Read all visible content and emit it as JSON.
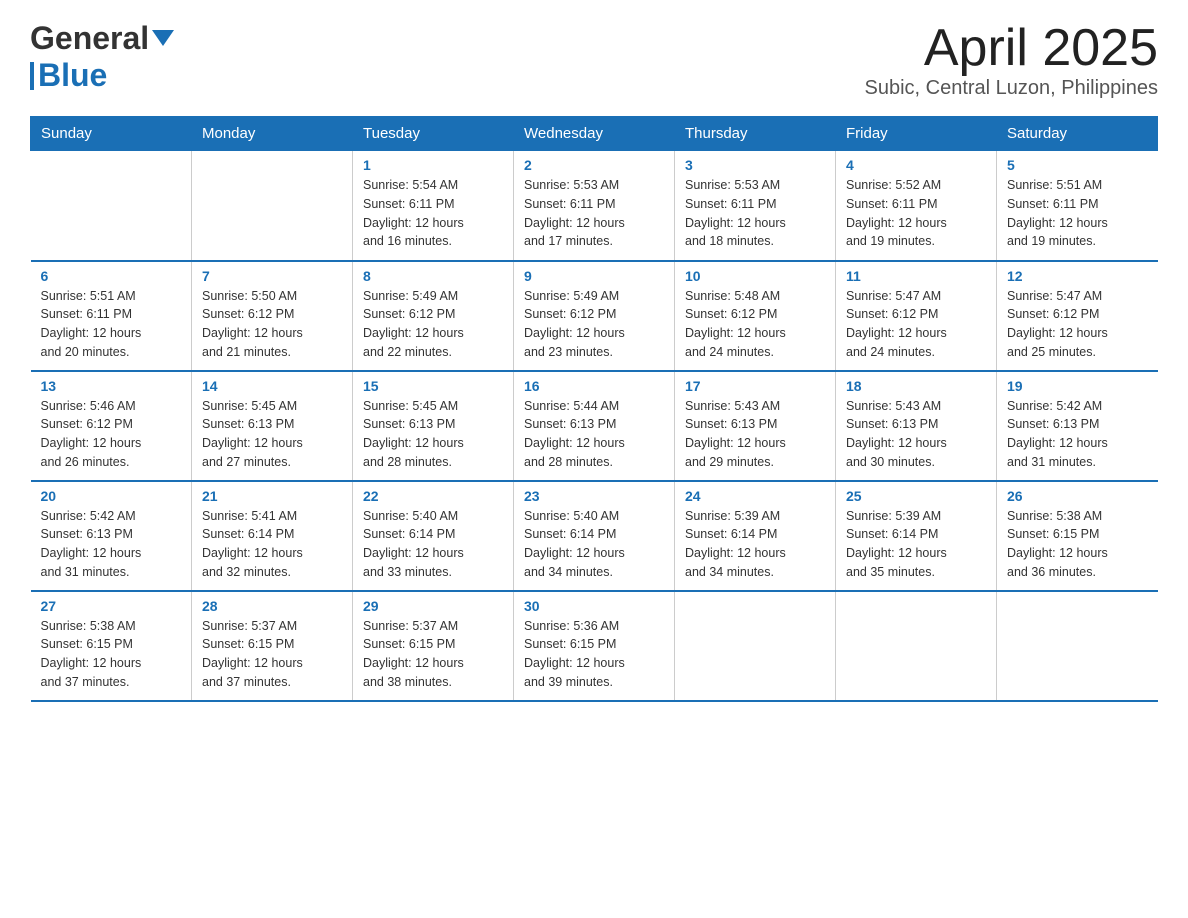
{
  "header": {
    "logo_general": "General",
    "logo_blue": "Blue",
    "title": "April 2025",
    "subtitle": "Subic, Central Luzon, Philippines"
  },
  "weekdays": [
    "Sunday",
    "Monday",
    "Tuesday",
    "Wednesday",
    "Thursday",
    "Friday",
    "Saturday"
  ],
  "weeks": [
    [
      {
        "day": "",
        "info": ""
      },
      {
        "day": "",
        "info": ""
      },
      {
        "day": "1",
        "info": "Sunrise: 5:54 AM\nSunset: 6:11 PM\nDaylight: 12 hours\nand 16 minutes."
      },
      {
        "day": "2",
        "info": "Sunrise: 5:53 AM\nSunset: 6:11 PM\nDaylight: 12 hours\nand 17 minutes."
      },
      {
        "day": "3",
        "info": "Sunrise: 5:53 AM\nSunset: 6:11 PM\nDaylight: 12 hours\nand 18 minutes."
      },
      {
        "day": "4",
        "info": "Sunrise: 5:52 AM\nSunset: 6:11 PM\nDaylight: 12 hours\nand 19 minutes."
      },
      {
        "day": "5",
        "info": "Sunrise: 5:51 AM\nSunset: 6:11 PM\nDaylight: 12 hours\nand 19 minutes."
      }
    ],
    [
      {
        "day": "6",
        "info": "Sunrise: 5:51 AM\nSunset: 6:11 PM\nDaylight: 12 hours\nand 20 minutes."
      },
      {
        "day": "7",
        "info": "Sunrise: 5:50 AM\nSunset: 6:12 PM\nDaylight: 12 hours\nand 21 minutes."
      },
      {
        "day": "8",
        "info": "Sunrise: 5:49 AM\nSunset: 6:12 PM\nDaylight: 12 hours\nand 22 minutes."
      },
      {
        "day": "9",
        "info": "Sunrise: 5:49 AM\nSunset: 6:12 PM\nDaylight: 12 hours\nand 23 minutes."
      },
      {
        "day": "10",
        "info": "Sunrise: 5:48 AM\nSunset: 6:12 PM\nDaylight: 12 hours\nand 24 minutes."
      },
      {
        "day": "11",
        "info": "Sunrise: 5:47 AM\nSunset: 6:12 PM\nDaylight: 12 hours\nand 24 minutes."
      },
      {
        "day": "12",
        "info": "Sunrise: 5:47 AM\nSunset: 6:12 PM\nDaylight: 12 hours\nand 25 minutes."
      }
    ],
    [
      {
        "day": "13",
        "info": "Sunrise: 5:46 AM\nSunset: 6:12 PM\nDaylight: 12 hours\nand 26 minutes."
      },
      {
        "day": "14",
        "info": "Sunrise: 5:45 AM\nSunset: 6:13 PM\nDaylight: 12 hours\nand 27 minutes."
      },
      {
        "day": "15",
        "info": "Sunrise: 5:45 AM\nSunset: 6:13 PM\nDaylight: 12 hours\nand 28 minutes."
      },
      {
        "day": "16",
        "info": "Sunrise: 5:44 AM\nSunset: 6:13 PM\nDaylight: 12 hours\nand 28 minutes."
      },
      {
        "day": "17",
        "info": "Sunrise: 5:43 AM\nSunset: 6:13 PM\nDaylight: 12 hours\nand 29 minutes."
      },
      {
        "day": "18",
        "info": "Sunrise: 5:43 AM\nSunset: 6:13 PM\nDaylight: 12 hours\nand 30 minutes."
      },
      {
        "day": "19",
        "info": "Sunrise: 5:42 AM\nSunset: 6:13 PM\nDaylight: 12 hours\nand 31 minutes."
      }
    ],
    [
      {
        "day": "20",
        "info": "Sunrise: 5:42 AM\nSunset: 6:13 PM\nDaylight: 12 hours\nand 31 minutes."
      },
      {
        "day": "21",
        "info": "Sunrise: 5:41 AM\nSunset: 6:14 PM\nDaylight: 12 hours\nand 32 minutes."
      },
      {
        "day": "22",
        "info": "Sunrise: 5:40 AM\nSunset: 6:14 PM\nDaylight: 12 hours\nand 33 minutes."
      },
      {
        "day": "23",
        "info": "Sunrise: 5:40 AM\nSunset: 6:14 PM\nDaylight: 12 hours\nand 34 minutes."
      },
      {
        "day": "24",
        "info": "Sunrise: 5:39 AM\nSunset: 6:14 PM\nDaylight: 12 hours\nand 34 minutes."
      },
      {
        "day": "25",
        "info": "Sunrise: 5:39 AM\nSunset: 6:14 PM\nDaylight: 12 hours\nand 35 minutes."
      },
      {
        "day": "26",
        "info": "Sunrise: 5:38 AM\nSunset: 6:15 PM\nDaylight: 12 hours\nand 36 minutes."
      }
    ],
    [
      {
        "day": "27",
        "info": "Sunrise: 5:38 AM\nSunset: 6:15 PM\nDaylight: 12 hours\nand 37 minutes."
      },
      {
        "day": "28",
        "info": "Sunrise: 5:37 AM\nSunset: 6:15 PM\nDaylight: 12 hours\nand 37 minutes."
      },
      {
        "day": "29",
        "info": "Sunrise: 5:37 AM\nSunset: 6:15 PM\nDaylight: 12 hours\nand 38 minutes."
      },
      {
        "day": "30",
        "info": "Sunrise: 5:36 AM\nSunset: 6:15 PM\nDaylight: 12 hours\nand 39 minutes."
      },
      {
        "day": "",
        "info": ""
      },
      {
        "day": "",
        "info": ""
      },
      {
        "day": "",
        "info": ""
      }
    ]
  ]
}
